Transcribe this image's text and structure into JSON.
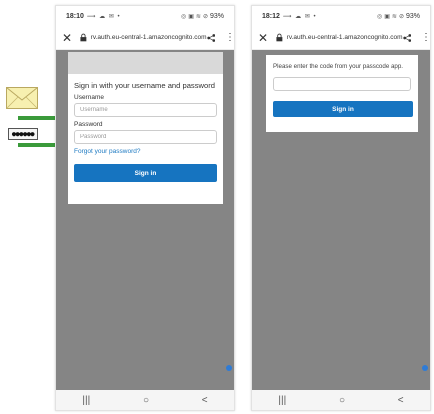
{
  "left_phone": {
    "status": {
      "time": "18:10",
      "icons": "⟿ ☁ ✉ •",
      "battery": "93%"
    },
    "url": "rv.auth.eu-central-1.amazoncognito.com",
    "login": {
      "heading": "Sign in with your username and password",
      "username_label": "Username",
      "username_placeholder": "Username",
      "password_label": "Password",
      "password_placeholder": "Password",
      "forgot_label": "Forgot your password?",
      "submit_label": "Sign in"
    }
  },
  "right_phone": {
    "status": {
      "time": "18:12",
      "icons": "⟿ ☁ ✉ •",
      "battery": "93%"
    },
    "url": "rv.auth.eu-central-1.amazoncognito.com",
    "mfa": {
      "message": "Please enter the code from your passcode app.",
      "code_value": "",
      "submit_label": "Sign in"
    }
  },
  "annotations": {
    "password_icon_text": "●●●●●●",
    "arrow_color": "#3a9a3a",
    "envelope_color": "#f7f0b0"
  },
  "nav": {
    "recents": "|||",
    "home": "○",
    "back": "<"
  }
}
